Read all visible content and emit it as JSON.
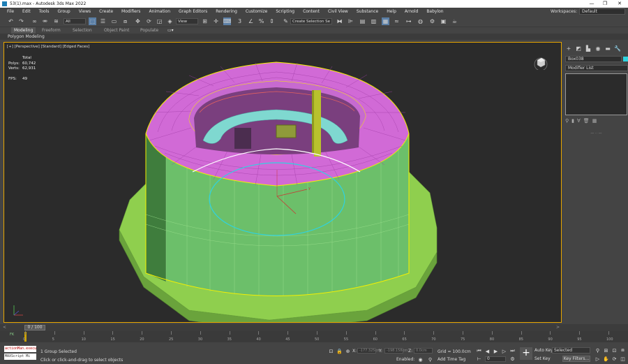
{
  "window": {
    "title": "53(1).max - Autodesk 3ds Max 2022",
    "min_glyph": "—",
    "max_glyph": "❐",
    "close_glyph": "✕"
  },
  "menu": {
    "items": [
      "File",
      "Edit",
      "Tools",
      "Group",
      "Views",
      "Create",
      "Modifiers",
      "Animation",
      "Graph Editors",
      "Rendering",
      "Customize",
      "Scripting",
      "Content",
      "Civil View",
      "Substance",
      "Help",
      "Arnold",
      "Babylon"
    ],
    "workspaces_label": "Workspaces:",
    "workspaces_value": "Default"
  },
  "toolbar": {
    "filter_value": "All",
    "view_value": "View",
    "selection_set": "Create Selection Se"
  },
  "ribbon": {
    "tabs": [
      "Modeling",
      "Freeform",
      "Selection",
      "Object Paint",
      "Populate"
    ],
    "active_tab": "Modeling",
    "sub_label": "Polygon Modeling"
  },
  "viewport": {
    "label": "[+] [Perspective] [Standard] [Edged Faces]",
    "stats": {
      "total_label": "Total",
      "polys_label": "Polys:",
      "polys_value": "60,742",
      "verts_label": "Verts:",
      "verts_value": "62,931",
      "fps_label": "FPS:",
      "fps_value": "49"
    },
    "colors": {
      "background": "#2b2b2b",
      "border_active": "#e8a600",
      "base_green": "#8fcf4e",
      "cylinder_green": "#6cbf6a",
      "top_magenta": "#d16ad6",
      "ring_cyan": "#7fd8d0",
      "selection_yellow": "#f5f000"
    }
  },
  "command_panel": {
    "object_name": "Box038",
    "object_color": "#2fd3e0",
    "modifier_list": "Modifier List"
  },
  "timeline": {
    "slider_label": "0 / 100",
    "ruler_ticks": [
      "0",
      "5",
      "10",
      "15",
      "20",
      "25",
      "30",
      "35",
      "40",
      "45",
      "50",
      "55",
      "60",
      "65",
      "70",
      "75",
      "80",
      "85",
      "90",
      "95",
      "100"
    ]
  },
  "status": {
    "maxscript_line1": "actionMan.execu",
    "maxscript_line2": "MAXScript Mi",
    "selection_count": "1 Group Selected",
    "prompt": "Click or click-and-drag to select objects",
    "x_label": "X:",
    "x_value": "-177.325cm",
    "y_label": "Y:",
    "y_value": "-198.158cm",
    "z_label": "Z:",
    "z_value": "0.0cm",
    "grid": "Grid = 100.0cm",
    "enabled": "Enabled:",
    "add_time_tag": "Add Time Tag",
    "frame_value": "0",
    "auto_key": "Auto Key",
    "set_key": "Set Key",
    "selected_value": "Selected",
    "key_filters": "Key Filters..."
  }
}
